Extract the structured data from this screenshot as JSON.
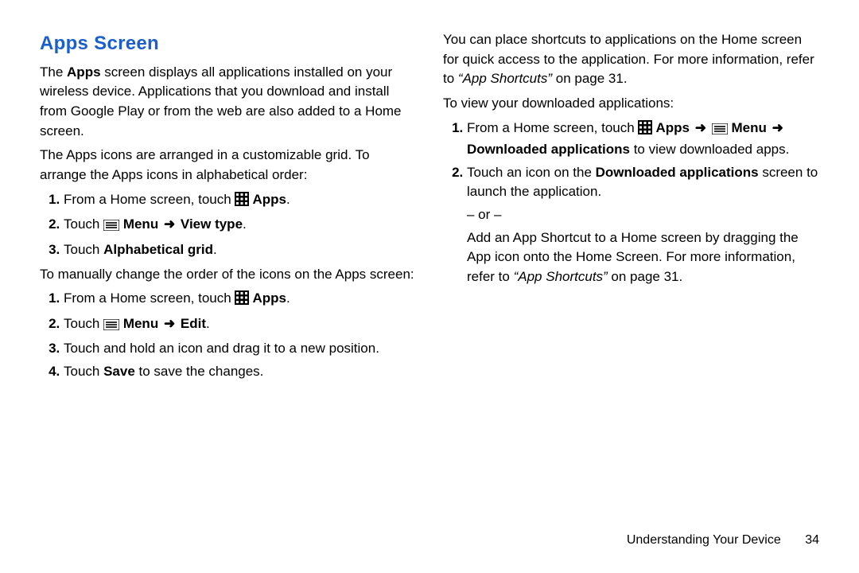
{
  "left": {
    "title": "Apps Screen",
    "intro1a": "The ",
    "intro1b": "Apps",
    "intro1c": " screen displays all applications installed on your wireless device. Applications that you download and install from Google Play or from the web are also added to a Home screen.",
    "intro2": "The Apps icons are arranged in a customizable grid. To arrange the Apps icons in alphabetical order:",
    "s1a": "From a Home screen, touch ",
    "s1b": " Apps",
    "s1c": ".",
    "s2a": "Touch ",
    "s2b": " Menu ",
    "s2c": " View type",
    "s2d": ".",
    "s3a": "Touch ",
    "s3b": "Alphabetical grid",
    "s3c": ".",
    "intro3": "To manually change the order of the icons on the Apps screen:",
    "t1a": "From a Home screen, touch ",
    "t1b": " Apps",
    "t1c": ".",
    "t2a": "Touch ",
    "t2b": " Menu ",
    "t2c": " Edit",
    "t2d": ".",
    "t3": "Touch and hold an icon and drag it to a new position.",
    "t4a": "Touch ",
    "t4b": "Save",
    "t4c": " to save the changes."
  },
  "right": {
    "p1a": "You can place shortcuts to applications on the Home screen for quick access to the application. For more information, refer to ",
    "p1b": "“App Shortcuts”",
    "p1c": " on page 31.",
    "p2": "To view your downloaded applications:",
    "u1a": "From a Home screen, touch ",
    "u1b": " Apps ",
    "u1c": " Menu ",
    "u1d": " Downloaded applications",
    "u1e": " to view downloaded apps.",
    "u2a": "Touch an icon on the ",
    "u2b": "Downloaded applications",
    "u2c": " screen to launch the application.",
    "or": "– or –",
    "u2d": "Add an App Shortcut to a Home screen by dragging the App icon onto the Home Screen. For more information, refer to ",
    "u2e": "“App Shortcuts”",
    "u2f": " on page 31."
  },
  "footer": {
    "section": "Understanding Your Device",
    "page": "34"
  },
  "arrow": "➜"
}
